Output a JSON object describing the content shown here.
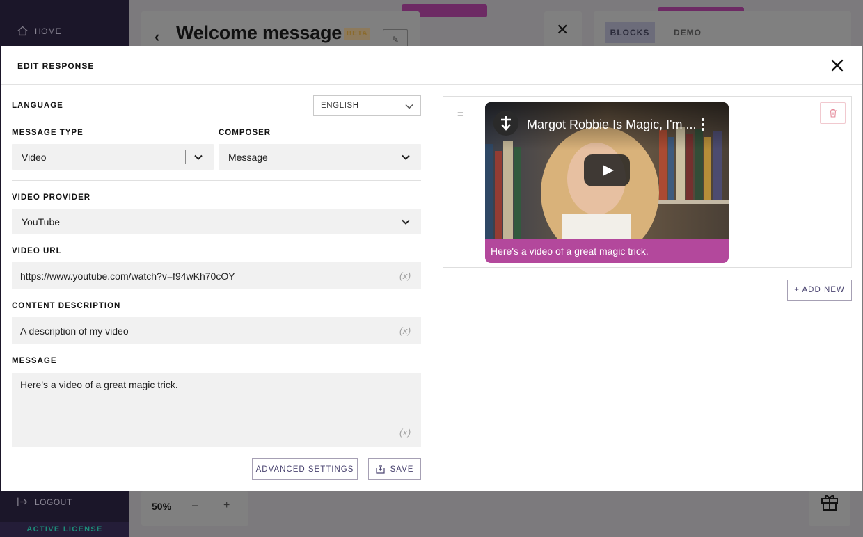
{
  "sidebar": {
    "home_label": "HOME",
    "logout_label": "LOGOUT",
    "license_label": "ACTIVE LICENSE"
  },
  "background": {
    "page_title": "Welcome message",
    "beta_badge": "BETA",
    "tabs": [
      {
        "label": "BLOCKS"
      },
      {
        "label": "DEMO"
      }
    ],
    "zoom_level": "50%",
    "zoom_minus": "–",
    "zoom_plus": "+"
  },
  "modal": {
    "title": "EDIT RESPONSE",
    "language": {
      "label": "LANGUAGE",
      "value": "ENGLISH"
    },
    "message_type": {
      "label": "MESSAGE TYPE",
      "value": "Video"
    },
    "composer": {
      "label": "COMPOSER",
      "value": "Message"
    },
    "video_provider": {
      "label": "VIDEO PROVIDER",
      "value": "YouTube"
    },
    "video_url": {
      "label": "VIDEO URL",
      "value": "https://www.youtube.com/watch?v=f94wKh70cOY",
      "var_hint": "(x)"
    },
    "content_description": {
      "label": "CONTENT DESCRIPTION",
      "value": "A description of my video",
      "var_hint": "(x)"
    },
    "message": {
      "label": "MESSAGE",
      "value": "Here's a video of a great magic trick.",
      "var_hint": "(x)"
    },
    "advanced_settings_label": "ADVANCED SETTINGS",
    "save_label": "SAVE"
  },
  "preview": {
    "video_title": "Margot Robbie Is Magic, I'm ...",
    "caption": "Here's a video of a great magic trick.",
    "add_new_label": "+ ADD NEW"
  },
  "colors": {
    "accent": "#b3489c",
    "sidebar_bg": "#1b1629",
    "button_text": "#4a4470"
  }
}
